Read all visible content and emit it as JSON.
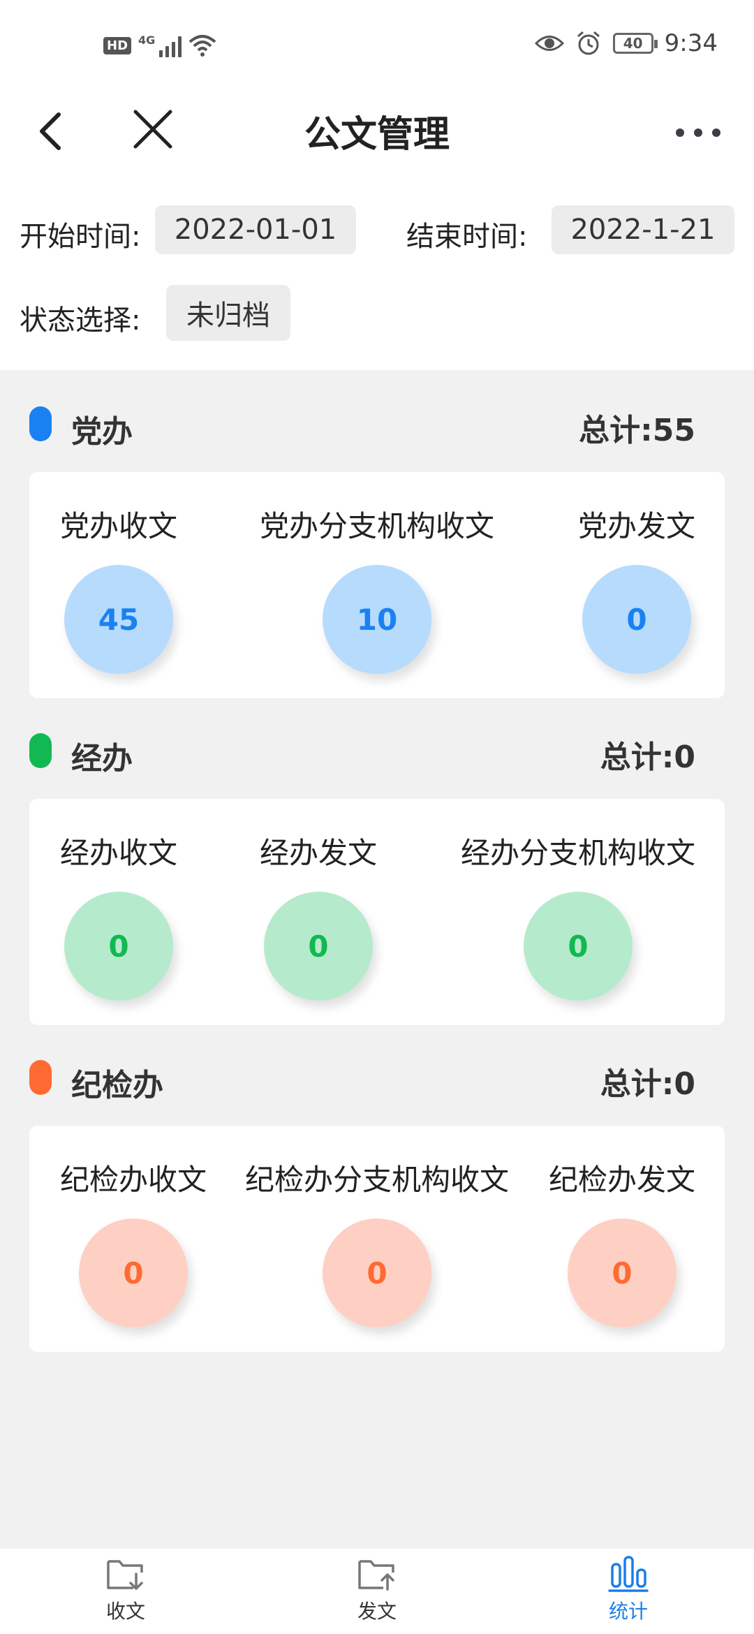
{
  "status_bar": {
    "network": "4G",
    "hd": "HD",
    "battery": "40",
    "time": "9:34"
  },
  "nav": {
    "title": "公文管理"
  },
  "filters": {
    "start_label": "开始时间:",
    "start_value": "2022-01-01",
    "end_label": "结束时间:",
    "end_value": "2022-1-21",
    "status_label": "状态选择:",
    "status_value": "未归档"
  },
  "sections": [
    {
      "title": "党办",
      "total": "总计:55",
      "color": "#1a82f0",
      "circle_bg": "#b7dbfd",
      "value_color": "#1a82f0",
      "stats": [
        {
          "label": "党办收文",
          "value": "45"
        },
        {
          "label": "党办分支机构收文",
          "value": "10"
        },
        {
          "label": "党办发文",
          "value": "0"
        }
      ]
    },
    {
      "title": "经办",
      "total": "总计:0",
      "color": "#12b852",
      "circle_bg": "#b5ebcc",
      "value_color": "#12b852",
      "stats": [
        {
          "label": "经办收文",
          "value": "0"
        },
        {
          "label": "经办发文",
          "value": "0"
        },
        {
          "label": "经办分支机构收文",
          "value": "0"
        }
      ]
    },
    {
      "title": "纪检办",
      "total": "总计:0",
      "color": "#ff6a33",
      "circle_bg": "#fdd0c3",
      "value_color": "#ff6a33",
      "stats": [
        {
          "label": "纪检办收文",
          "value": "0"
        },
        {
          "label": "纪检办分支机构收文",
          "value": "0"
        },
        {
          "label": "纪检办发文",
          "value": "0"
        }
      ]
    }
  ],
  "bottom_nav": {
    "tabs": [
      {
        "label": "收文",
        "icon": "folder-receive-icon"
      },
      {
        "label": "发文",
        "icon": "folder-send-icon"
      },
      {
        "label": "统计",
        "icon": "bar-chart-icon"
      }
    ],
    "active_color": "#1a7ee8"
  }
}
